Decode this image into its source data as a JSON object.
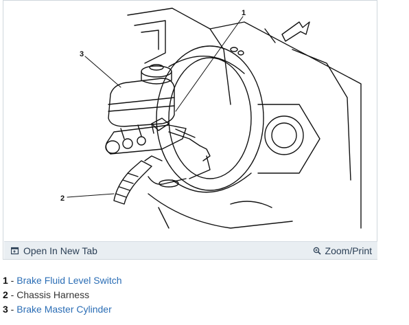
{
  "figure": {
    "callouts": [
      "1",
      "2",
      "3"
    ]
  },
  "toolbar": {
    "open_label": "Open In New Tab",
    "zoom_label": "Zoom/Print"
  },
  "legend": [
    {
      "num": "1",
      "sep": " - ",
      "label": "Brake Fluid Level Switch",
      "is_link": true
    },
    {
      "num": "2",
      "sep": " - ",
      "label": "Chassis Harness",
      "is_link": false
    },
    {
      "num": "3",
      "sep": " - ",
      "label": "Brake Master Cylinder",
      "is_link": true
    }
  ]
}
